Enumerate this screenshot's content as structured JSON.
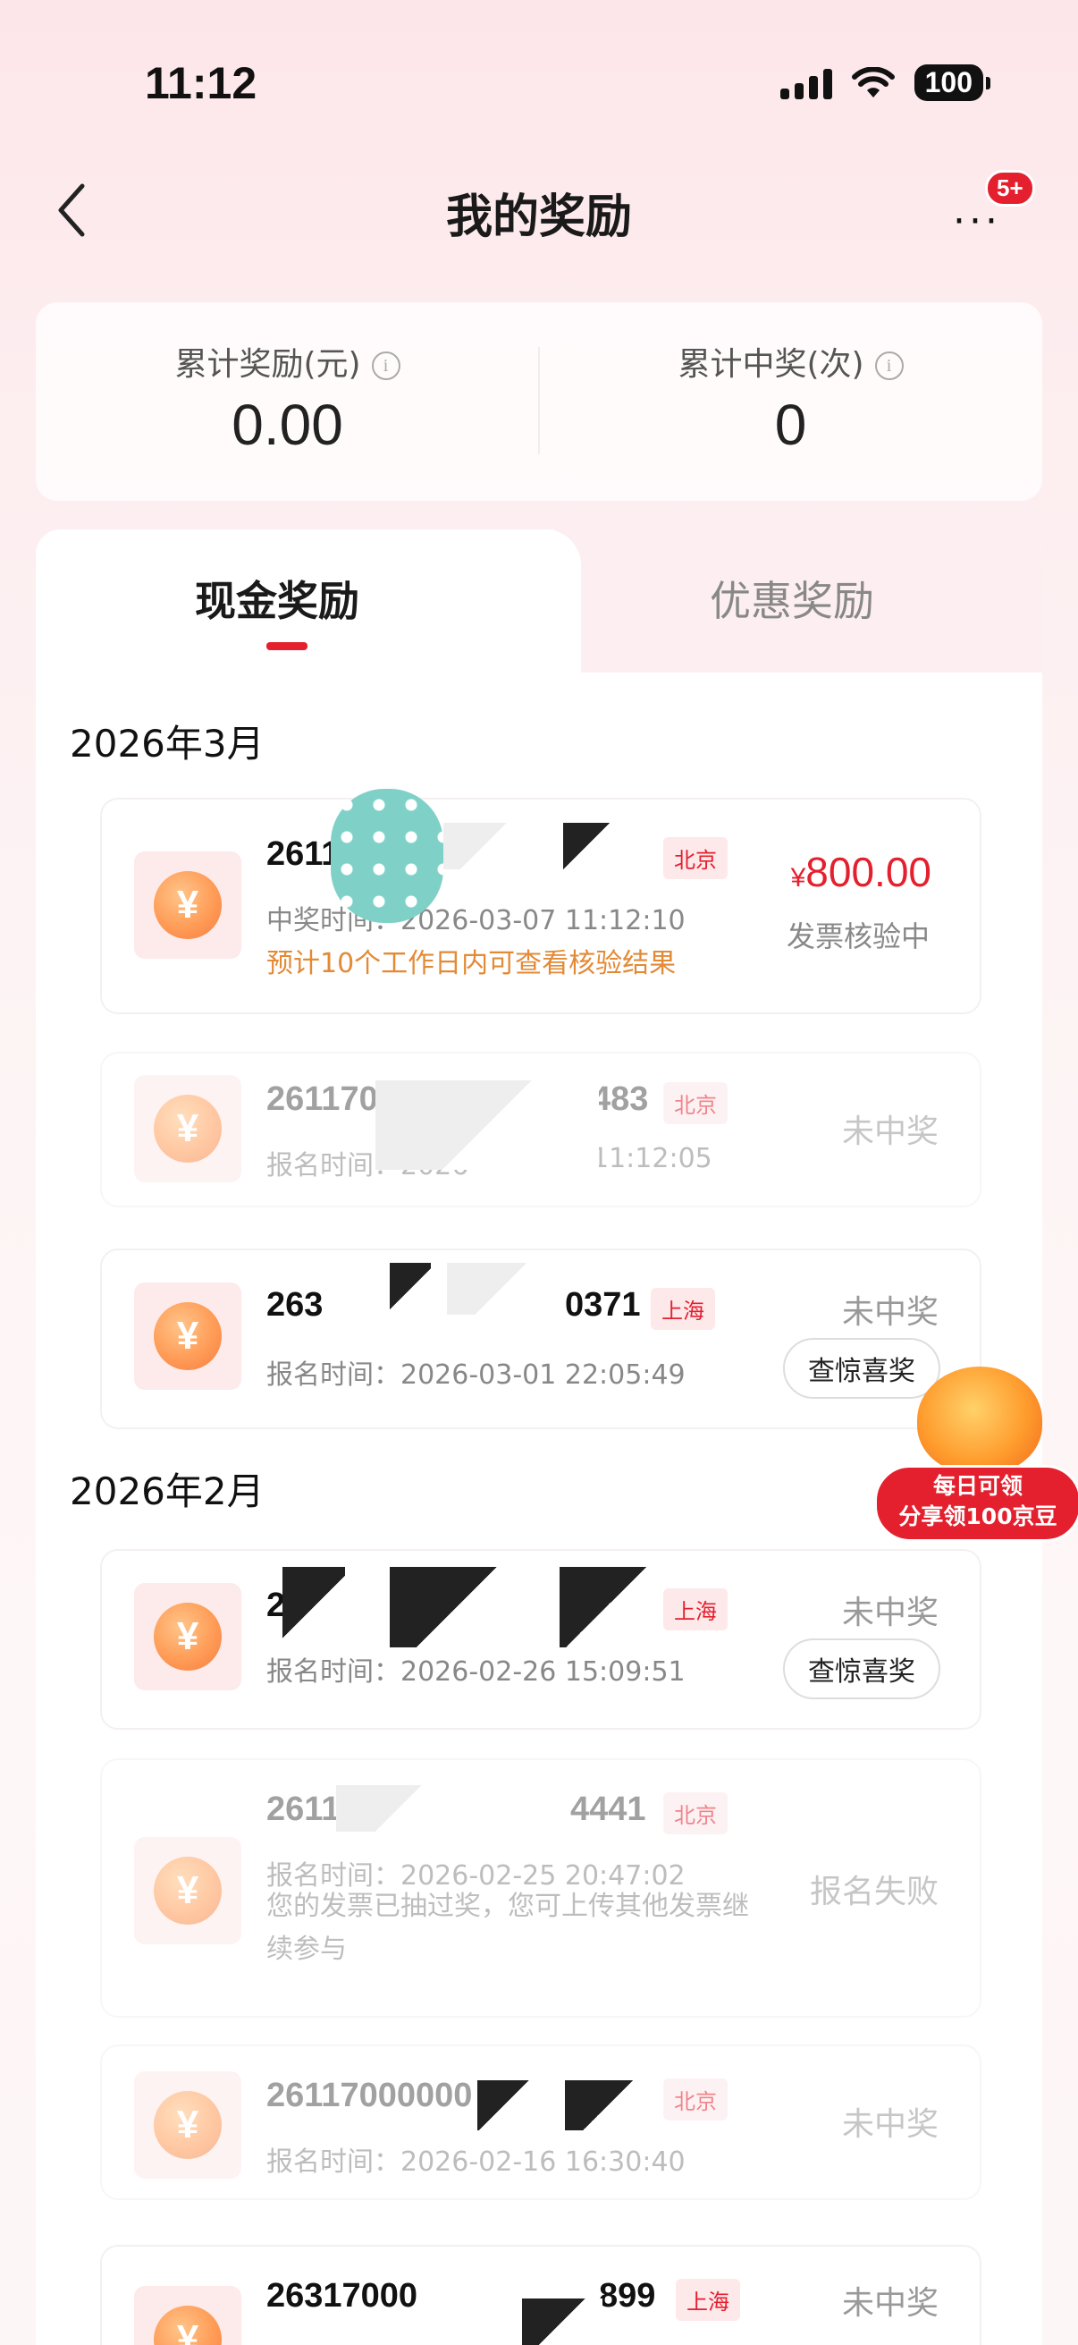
{
  "status_bar": {
    "time": "11:12",
    "battery": "100"
  },
  "nav": {
    "title": "我的奖励",
    "badge": "5+",
    "more": "···"
  },
  "summary": {
    "total_reward_label": "累计奖励(元)",
    "total_reward_value": "0.00",
    "total_wins_label": "累计中奖(次)",
    "total_wins_value": "0"
  },
  "tabs": [
    {
      "label": "现金奖励",
      "active": true
    },
    {
      "label": "优惠奖励",
      "active": false
    }
  ],
  "months": [
    {
      "label": "2026年3月"
    },
    {
      "label": "2026年2月"
    }
  ],
  "records": [
    {
      "id": "2611",
      "city": "北京",
      "time": "中奖时间：2026-03-07 11:12:10",
      "note": "预计10个工作日内可查看核验结果",
      "amount_symbol": "¥",
      "amount": "800.00",
      "status": "发票核验中"
    },
    {
      "id": "261170",
      "id_tail": "483",
      "city": "北京",
      "time": "报名时间：2026",
      "time_tail": "11:12:05",
      "status": "未中奖"
    },
    {
      "id": "263",
      "id_tail": "0371",
      "city": "上海",
      "time": "报名时间：2026-03-01 22:05:49",
      "status": "未中奖",
      "button": "查惊喜奖"
    },
    {
      "id": "2",
      "city": "上海",
      "time": "报名时间：2026-02-26 15:09:51",
      "status": "未中奖",
      "button": "查惊喜奖"
    },
    {
      "id": "261170",
      "id_tail": "4441",
      "city": "北京",
      "time": "报名时间：2026-02-25 20:47:02",
      "message": "您的发票已抽过奖，您可上传其他发票继续参与",
      "status": "报名失败"
    },
    {
      "id": "26117000000",
      "city": "北京",
      "time": "报名时间：2026-02-16 16:30:40",
      "status": "未中奖"
    },
    {
      "id": "26317000",
      "id_tail": "899",
      "city": "上海",
      "status": "未中奖"
    }
  ],
  "promo": {
    "line1": "每日可领",
    "line2": "分享领100京豆"
  }
}
